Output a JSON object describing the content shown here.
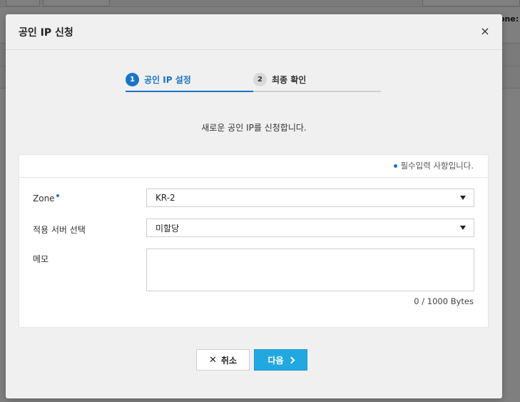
{
  "background": {
    "zone_label": "one:"
  },
  "modal": {
    "title": "공인 IP 신청",
    "close_symbol": "×"
  },
  "steps": [
    {
      "num": "1",
      "label": "공인 IP 설정"
    },
    {
      "num": "2",
      "label": "최종 확인"
    }
  ],
  "description": "새로운 공인 IP를 신청합니다.",
  "form": {
    "required_note": "필수입력 사항입니다.",
    "zone": {
      "label": "Zone",
      "value": "KR-2"
    },
    "server": {
      "label": "적용 서버 선택",
      "value": "미할당"
    },
    "memo": {
      "label": "메모",
      "value": "",
      "byte_count": "0 / 1000 Bytes"
    }
  },
  "buttons": {
    "cancel_label": "취소",
    "next_label": "다음"
  },
  "colors": {
    "accent": "#1a74c4",
    "primary_button": "#22a8e0"
  }
}
